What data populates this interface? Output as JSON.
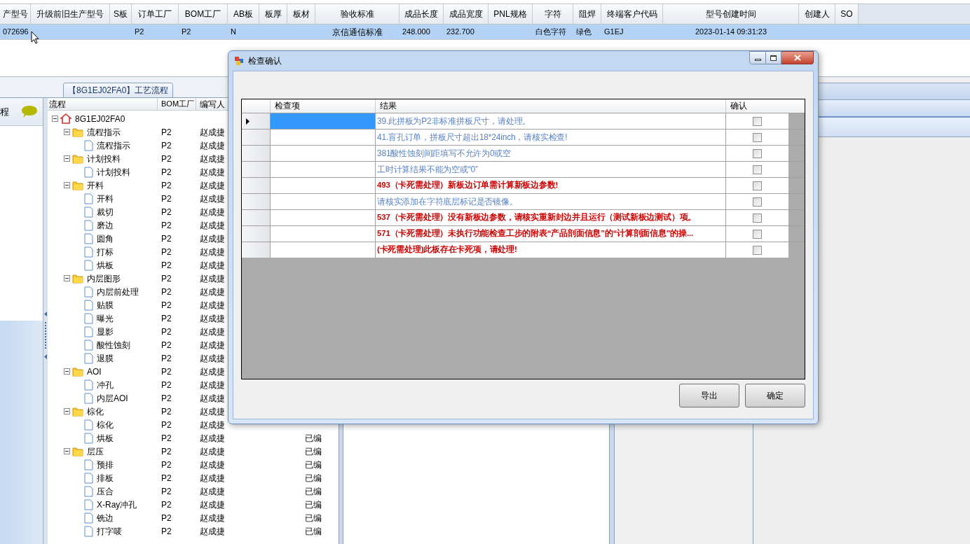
{
  "grid": {
    "columns": [
      {
        "heading": "产型号",
        "cell": "072696"
      },
      {
        "heading": "升级前旧生产型号"
      },
      {
        "heading": "S板"
      },
      {
        "heading": "订单工厂",
        "cell": "P2"
      },
      {
        "heading": "BOM工厂",
        "cell": "P2"
      },
      {
        "heading": "AB板",
        "cell": "N"
      },
      {
        "heading": "板厚"
      },
      {
        "heading": "板材"
      },
      {
        "heading": "验收标准",
        "cell": "京信通信标准"
      },
      {
        "heading": "成品长度",
        "cell": "248.000"
      },
      {
        "heading": "成品宽度",
        "cell": "232.700"
      },
      {
        "heading": "PNL规格"
      },
      {
        "heading": "字符",
        "cell": "白色字符"
      },
      {
        "heading": "阻焊",
        "cell": "绿色"
      },
      {
        "heading": "终端客户代码",
        "cell": "G1EJ"
      },
      {
        "heading": "型号创建时间",
        "cell": "2023-01-14 09:31:23"
      },
      {
        "heading": "创建人"
      },
      {
        "heading": "SO"
      }
    ],
    "row": {
      "selected": true
    }
  },
  "process_tab": {
    "label": "【8G1EJ02FA0】工艺流程"
  },
  "side_panel": {
    "label": "程"
  },
  "tree": {
    "columns": [
      "流程",
      "BOM工厂",
      "编写人"
    ],
    "root": {
      "label": "8G1EJ02FA0",
      "expanded": true,
      "children": [
        {
          "label": "流程指示",
          "bom": "P2",
          "writer": "赵成捷",
          "expanded": true,
          "children": [
            {
              "label": "流程指示",
              "bom": "P2",
              "writer": "赵成捷"
            }
          ]
        },
        {
          "label": "计划投料",
          "bom": "P2",
          "writer": "赵成捷",
          "expanded": true,
          "children": [
            {
              "label": "计划投料",
              "bom": "P2",
              "writer": "赵成捷"
            }
          ]
        },
        {
          "label": "开料",
          "bom": "P2",
          "writer": "赵成捷",
          "expanded": true,
          "children": [
            {
              "label": "开料",
              "bom": "P2",
              "writer": "赵成捷"
            },
            {
              "label": "裁切",
              "bom": "P2",
              "writer": "赵成捷"
            },
            {
              "label": "磨边",
              "bom": "P2",
              "writer": "赵成捷"
            },
            {
              "label": "圆角",
              "bom": "P2",
              "writer": "赵成捷"
            },
            {
              "label": "打标",
              "bom": "P2",
              "writer": "赵成捷"
            },
            {
              "label": "烘板",
              "bom": "P2",
              "writer": "赵成捷"
            }
          ]
        },
        {
          "label": "内层图形",
          "bom": "P2",
          "writer": "赵成捷",
          "expanded": true,
          "children": [
            {
              "label": "内层前处理",
              "bom": "P2",
              "writer": "赵成捷"
            },
            {
              "label": "贴膜",
              "bom": "P2",
              "writer": "赵成捷"
            },
            {
              "label": "曝光",
              "bom": "P2",
              "writer": "赵成捷"
            },
            {
              "label": "显影",
              "bom": "P2",
              "writer": "赵成捷"
            },
            {
              "label": "酸性蚀刻",
              "bom": "P2",
              "writer": "赵成捷"
            },
            {
              "label": "退膜",
              "bom": "P2",
              "writer": "赵成捷"
            }
          ]
        },
        {
          "label": "AOI",
          "bom": "P2",
          "writer": "赵成捷",
          "expanded": true,
          "children": [
            {
              "label": "冲孔",
              "bom": "P2",
              "writer": "赵成捷"
            },
            {
              "label": "内层AOI",
              "bom": "P2",
              "writer": "赵成捷"
            }
          ]
        },
        {
          "label": "棕化",
          "bom": "P2",
          "writer": "赵成捷",
          "expanded": true,
          "children": [
            {
              "label": "棕化",
              "bom": "P2",
              "writer": "赵成捷"
            },
            {
              "label": "烘板",
              "bom": "P2",
              "writer": "赵成捷",
              "status": "已编"
            }
          ]
        },
        {
          "label": "层压",
          "bom": "P2",
          "writer": "赵成捷",
          "status": "已编",
          "expanded": true,
          "children": [
            {
              "label": "预排",
              "bom": "P2",
              "writer": "赵成捷",
              "status": "已编"
            },
            {
              "label": "排板",
              "bom": "P2",
              "writer": "赵成捷",
              "status": "已编"
            },
            {
              "label": "压合",
              "bom": "P2",
              "writer": "赵成捷",
              "status": "已编"
            },
            {
              "label": "X-Ray冲孔",
              "bom": "P2",
              "writer": "赵成捷",
              "status": "已编"
            },
            {
              "label": "铣边",
              "bom": "P2",
              "writer": "赵成捷",
              "status": "已编"
            },
            {
              "label": "打字唛",
              "bom": "P2",
              "writer": "赵成捷",
              "status": "已编"
            }
          ]
        }
      ]
    }
  },
  "dialog": {
    "title": "检查确认",
    "columns": [
      "检查项",
      "结果",
      "确认"
    ],
    "rows": [
      {
        "result": "39.此拼板为P2非标准拼板尺寸，请处理。",
        "kind": "notice",
        "selected": true,
        "checked": false
      },
      {
        "result": "41.盲孔订单，拼板尺寸超出18*24inch，请核实检查!",
        "kind": "notice",
        "selected": false,
        "checked": false
      },
      {
        "result": "381酸性蚀刻间距填写不允许为0或空",
        "kind": "notice",
        "selected": false,
        "checked": false
      },
      {
        "result": "工时计算结果不能为空或“0”",
        "kind": "notice",
        "selected": false,
        "checked": false
      },
      {
        "result": "493（卡死需处理）新板边订单需计算新板边参数!",
        "kind": "fatal",
        "selected": false,
        "checked": false
      },
      {
        "result": "请核实添加在字符底层标记是否镜像。",
        "kind": "notice",
        "selected": false,
        "checked": false
      },
      {
        "result": "537（卡死需处理）没有新板边参数，请核实重新封边并且运行（测试新板边测试）项。",
        "kind": "fatal",
        "selected": false,
        "checked": false
      },
      {
        "result": "571（卡死需处理）未执行功能检查工步的附表“产品剖面信息”的“计算剖面信息”的操...",
        "kind": "fatal",
        "selected": false,
        "checked": false
      },
      {
        "result": "(卡死需处理)此板存在卡死项，请处理!",
        "kind": "fatal",
        "selected": false,
        "checked": false
      }
    ],
    "buttons": [
      "导出",
      "确定"
    ]
  }
}
